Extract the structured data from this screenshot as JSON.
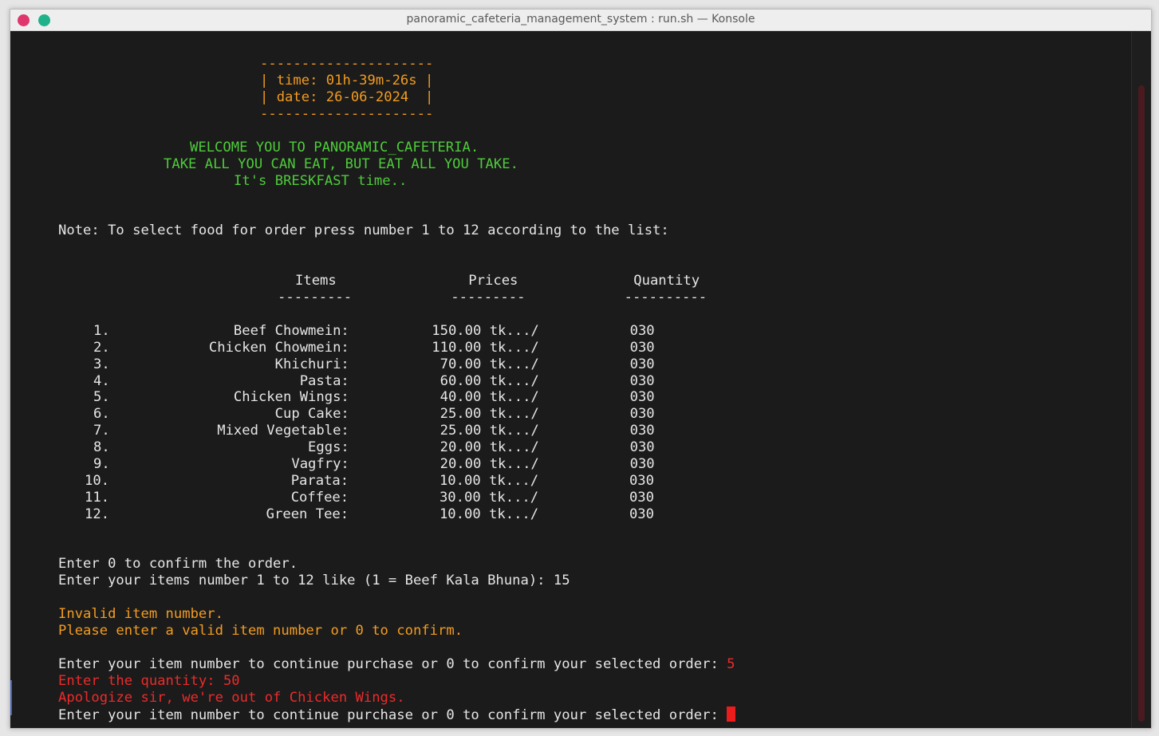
{
  "window": {
    "title": "panoramic_cafeteria_management_system : run.sh — Konsole"
  },
  "terminal": {
    "clock_box": [
      "---------------------",
      "| time: 01h-39m-26s |",
      "| date: 26-06-2024  |",
      "---------------------"
    ],
    "welcome": [
      "WELCOME YOU TO PANORAMIC_CAFETERIA.",
      "TAKE ALL YOU CAN EAT, BUT EAT ALL YOU TAKE.",
      "It's BRESKFAST time.."
    ],
    "note": "Note: To select food for order press number 1 to 12 according to the list:",
    "menu_header": "Items                Prices              Quantity",
    "menu_divider": "---------            ---------            ----------",
    "menu_rows": [
      "1.               Beef Chowmein:          150.00 tk.../           030",
      "2.            Chicken Chowmein:          110.00 tk.../           030",
      "3.                    Khichuri:           70.00 tk.../           030",
      "4.                       Pasta:           60.00 tk.../           030",
      "5.               Chicken Wings:           40.00 tk.../           030",
      "6.                    Cup Cake:           25.00 tk.../           030",
      "7.             Mixed Vegetable:           25.00 tk.../           030",
      "8.                        Eggs:           20.00 tk.../           030",
      "9.                      Vagfry:           20.00 tk.../           030",
      "10.                      Parata:           10.00 tk.../           030",
      "11.                      Coffee:           30.00 tk.../           030",
      "12.                   Green Tee:           10.00 tk.../           030"
    ],
    "confirm_hint": "Enter 0 to confirm the order.",
    "item_prompt": "Enter your items number 1 to 12 like (1 = Beef Kala Bhuna): 15",
    "invalid_msg": "Invalid item number.",
    "valid_hint": "Please enter a valid item number or 0 to confirm.",
    "continue_prompt": "Enter your item number to continue purchase or 0 to confirm your selected order: ",
    "continue_input": "5",
    "quantity_line": "Enter the quantity: 50",
    "apology": "Apologize sir, we're out of Chicken Wings.",
    "final_prompt": "Enter your item number to continue purchase or 0 to confirm your selected order: "
  },
  "colors": {
    "background": "#1b1b1b",
    "orange": "#f39c1f",
    "green": "#4ecb3a",
    "red": "#ec2b2b",
    "text": "#e6e6e6"
  }
}
